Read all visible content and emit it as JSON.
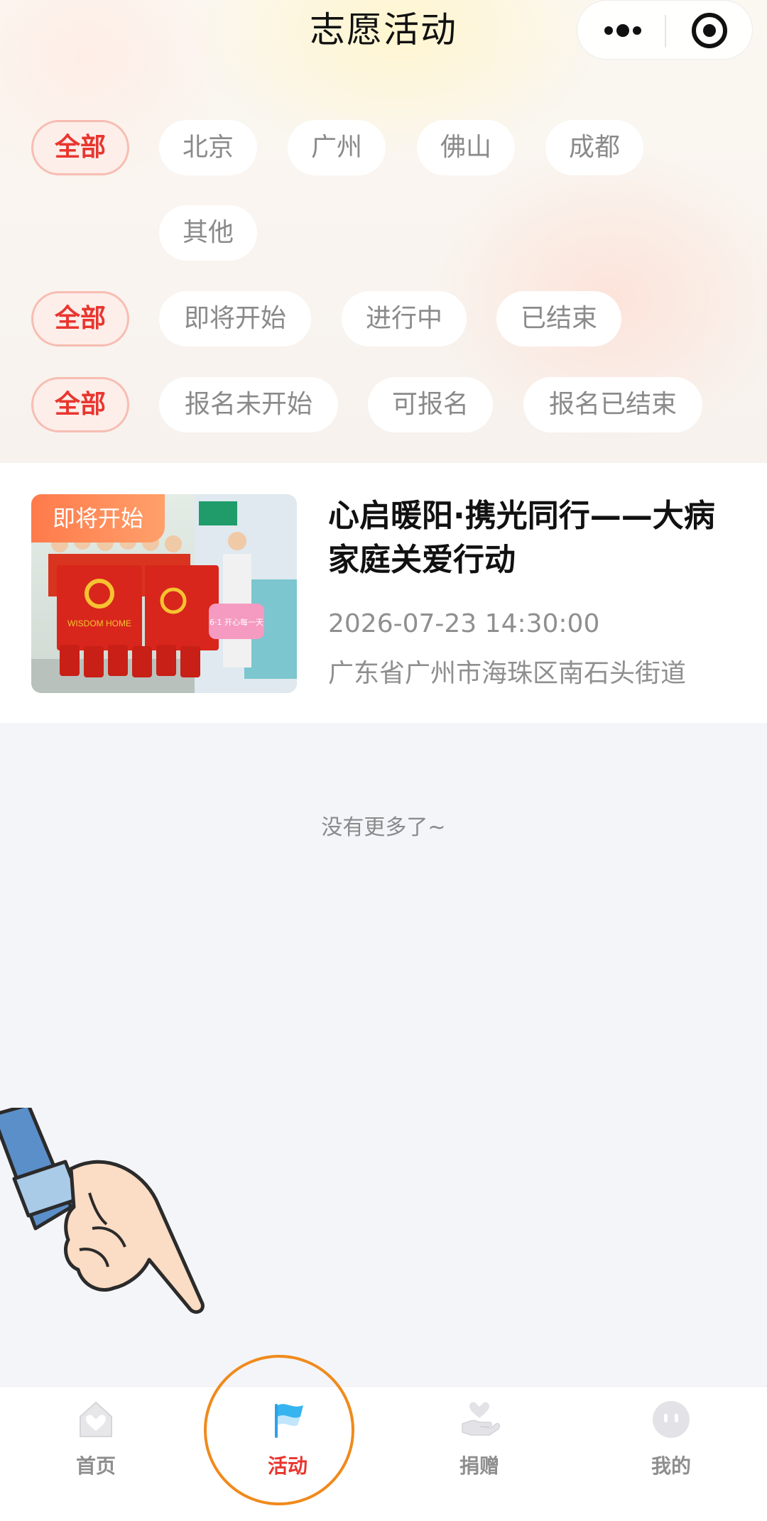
{
  "header": {
    "title": "志愿活动"
  },
  "filters": {
    "city": {
      "all": "全部",
      "options": [
        "北京",
        "广州",
        "佛山",
        "成都",
        "其他"
      ]
    },
    "status": {
      "all": "全部",
      "options": [
        "即将开始",
        "进行中",
        "已结束"
      ]
    },
    "signup": {
      "all": "全部",
      "options": [
        "报名未开始",
        "可报名",
        "报名已结束"
      ]
    }
  },
  "activities": [
    {
      "badge": "即将开始",
      "title": "心启暖阳·携光同行——大病家庭关爱行动",
      "time": "2026-07-23 14:30:00",
      "address": "广东省广州市海珠区南石头街道",
      "photo_banner_text": "WISDOM HOME",
      "photo_sign_text": "6·1 开心每一天"
    }
  ],
  "list_end_text": "没有更多了~",
  "tabbar": {
    "items": [
      {
        "label": "首页",
        "icon": "home-icon"
      },
      {
        "label": "活动",
        "icon": "flag-icon"
      },
      {
        "label": "捐赠",
        "icon": "donate-hand-heart-icon"
      },
      {
        "label": "我的",
        "icon": "profile-face-icon"
      }
    ],
    "active_index": 1
  },
  "colors": {
    "accent": "#e8362f",
    "badge_orange": "#ff7a4b",
    "highlight_circle": "#f08a1c"
  }
}
